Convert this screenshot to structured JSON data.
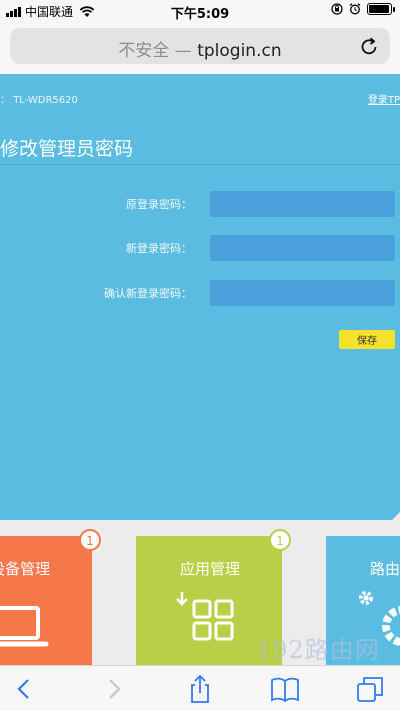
{
  "status_bar": {
    "carrier": "中国联通",
    "time": "下午5:09",
    "battery_level": 0.95
  },
  "browser": {
    "security_label": "不安全",
    "separator": " — ",
    "domain": "tplogin.cn"
  },
  "router": {
    "model_prefix": "：",
    "model": "TL-WDR5620",
    "login_link": "登录TP"
  },
  "password_section": {
    "title": "修改管理员密码",
    "fields": [
      {
        "label": "原登录密码：",
        "value": ""
      },
      {
        "label": "新登录密码：",
        "value": ""
      },
      {
        "label": "确认新登录密码：",
        "value": ""
      }
    ],
    "save_label": "保存"
  },
  "tiles": [
    {
      "label": "设备管理",
      "badge": "1",
      "icon": "laptop-icon",
      "color": "#f5774a"
    },
    {
      "label": "应用管理",
      "badge": "1",
      "icon": "apps-grid-icon",
      "color": "#b8cf47"
    },
    {
      "label": "路由",
      "icon": "gear-icon",
      "color": "#5bbce1"
    }
  ],
  "watermark": "192路由网",
  "colors": {
    "panel": "#5bbce1",
    "input": "#4aa1dc",
    "save_button": "#f4e12b"
  }
}
